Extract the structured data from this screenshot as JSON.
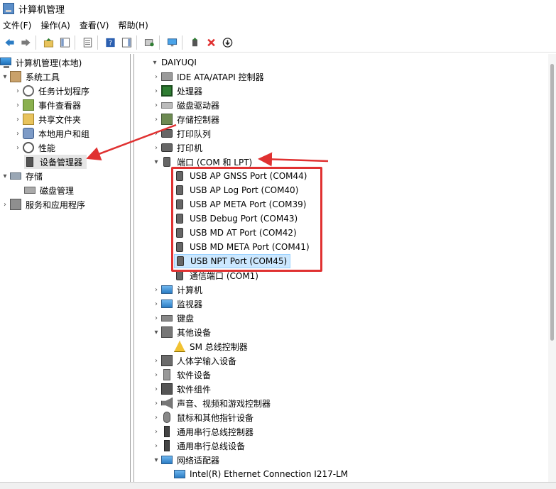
{
  "window": {
    "title": "计算机管理"
  },
  "menu": [
    "文件(F)",
    "操作(A)",
    "查看(V)",
    "帮助(H)"
  ],
  "toolbar": {
    "buttons": [
      "back-icon",
      "forward-icon",
      "up-folder-icon",
      "show-hide-tree-icon",
      "properties-icon",
      "help-icon",
      "show-action-pane-icon",
      "scan-hardware-icon",
      "monitor-icon",
      "update-driver-icon",
      "uninstall-icon",
      "disable-device-icon"
    ]
  },
  "left_tree": {
    "root": "计算机管理(本地)",
    "system_tools": "系统工具",
    "task_scheduler": "任务计划程序",
    "event_viewer": "事件查看器",
    "shared_folders": "共享文件夹",
    "local_users": "本地用户和组",
    "performance": "性能",
    "device_manager": "设备管理器",
    "storage": "存储",
    "disk_management": "磁盘管理",
    "services": "服务和应用程序"
  },
  "device_tree": {
    "root": "DAIYUQI",
    "categories": {
      "ide": "IDE ATA/ATAPI 控制器",
      "cpu": "处理器",
      "disk": "磁盘驱动器",
      "storage": "存储控制器",
      "print_queue": "打印队列",
      "printer": "打印机",
      "ports": "端口 (COM 和 LPT)",
      "computer": "计算机",
      "monitor": "监视器",
      "keyboard": "键盘",
      "other": "其他设备",
      "hid": "人体学输入设备",
      "software_device": "软件设备",
      "software_component": "软件组件",
      "sound": "声音、视频和游戏控制器",
      "mouse": "鼠标和其他指针设备",
      "usb1": "通用串行总线控制器",
      "usb2": "通用串行总线设备",
      "network": "网络适配器"
    },
    "ports": [
      "USB AP GNSS Port (COM44)",
      "USB AP Log Port (COM40)",
      "USB AP META Port (COM39)",
      "USB Debug Port (COM43)",
      "USB MD AT Port (COM42)",
      "USB MD META Port (COM41)",
      "USB NPT Port (COM45)",
      "通信端口 (COM1)"
    ],
    "other_devices": [
      "SM 总线控制器"
    ],
    "network_adapters": [
      "Intel(R) Ethernet Connection I217-LM"
    ]
  },
  "colors": {
    "annotation": "#e03131",
    "selection": "#cce8ff"
  }
}
